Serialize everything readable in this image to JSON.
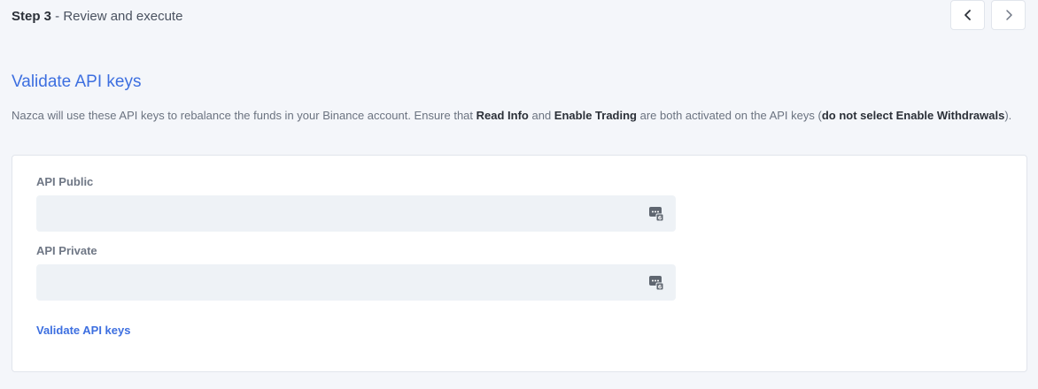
{
  "header": {
    "step_number": "Step 3",
    "step_title": " - Review and execute"
  },
  "nav": {
    "prev_icon": "chevron-left-icon",
    "next_icon": "chevron-right-icon"
  },
  "section": {
    "title": "Validate API keys",
    "description": {
      "part1": "Nazca will use these API keys to rebalance the funds in your Binance account. Ensure that ",
      "read_info": "Read Info",
      "part2": " and ",
      "enable_trading": "Enable Trading",
      "part3": " are both activated on the API keys (",
      "warning": "do not select Enable Withdrawals",
      "part4": ")."
    }
  },
  "form": {
    "public_label": "API Public",
    "public_value": "",
    "private_label": "API Private",
    "private_value": "",
    "field_icon": "password-manager-icon",
    "validate_label": "Validate API keys"
  },
  "colors": {
    "accent": "#3d6fe0",
    "background": "#f4f6fa",
    "input_bg": "#eef2f6"
  }
}
